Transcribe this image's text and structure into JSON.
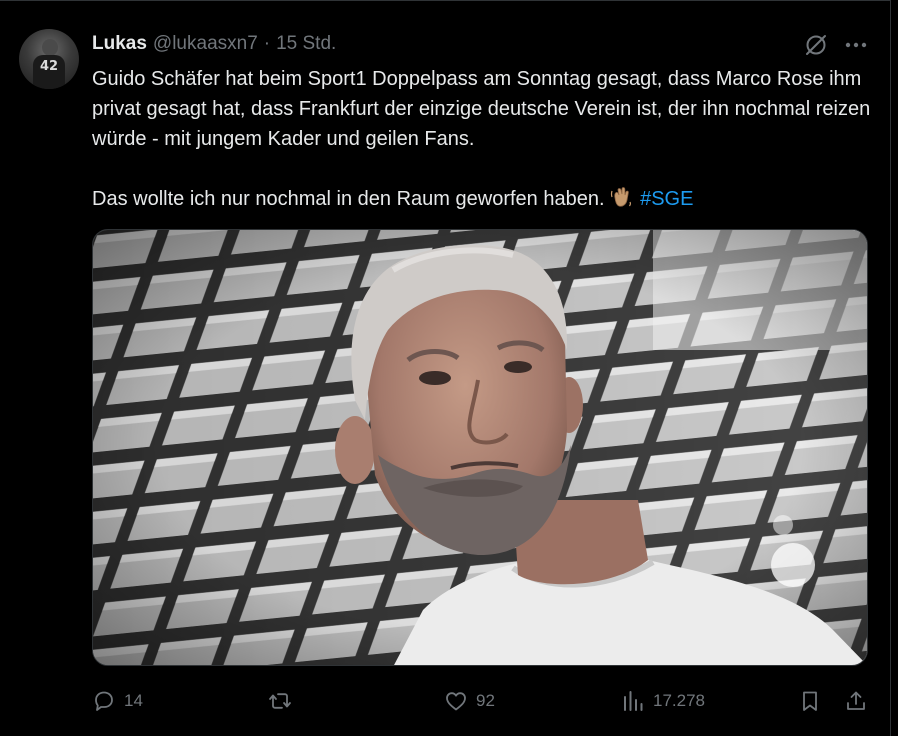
{
  "tweet": {
    "author_name": "Lukas",
    "author_handle": "@lukaasxn7",
    "separator": "·",
    "timestamp": "15 Std.",
    "avatar_jersey_number": "42",
    "paragraph_1": "Guido Schäfer hat beim Sport1 Doppelpass am Sonntag gesagt, dass Marco Rose ihm privat gesagt hat, dass Frankfurt der einzige deutsche Verein ist, der ihn nochmal reizen würde - mit jungem Kader und geilen Fans.",
    "paragraph_2": "Das wollte ich nur nochmal in den Raum geworfen haben.",
    "emoji": "waving-hand-emoji",
    "hashtag": "#SGE",
    "media_description": "photo-of-man-with-grey-hair-and-beard-in-white-shirt-under-stadium-roof"
  },
  "actions": {
    "replies": "14",
    "reposts": "",
    "likes": "92",
    "views": "17.278"
  },
  "icons": {
    "header_right": [
      "grok-icon",
      "more-icon"
    ],
    "action_bar": [
      "reply-icon",
      "repost-icon",
      "like-icon",
      "views-icon",
      "bookmark-icon",
      "share-icon"
    ]
  },
  "colors": {
    "background": "#000000",
    "text": "#e7e9ea",
    "secondary": "#71767b",
    "accent": "#1d9bf0",
    "border": "#2f3336"
  }
}
